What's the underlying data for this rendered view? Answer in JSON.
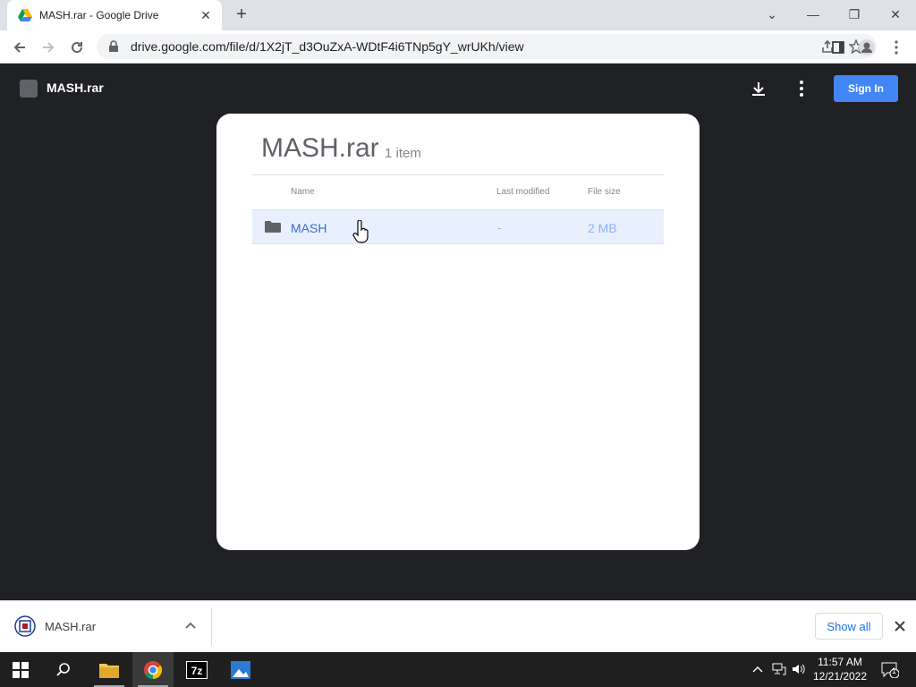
{
  "browser": {
    "tab_title": "MASH.rar - Google Drive",
    "new_tab_label": "+",
    "url": "drive.google.com/file/d/1X2jT_d3OuZxA-WDtF4i6TNp5gY_wrUKh/view"
  },
  "viewer": {
    "file_name": "MASH.rar",
    "sign_in_label": "Sign In",
    "card": {
      "title": "MASH.rar",
      "count": "1 item",
      "columns": [
        "Name",
        "Last modified",
        "File size"
      ],
      "rows": [
        {
          "name": "MASH",
          "modified": "-",
          "size": "2 MB"
        }
      ]
    }
  },
  "downloads": {
    "item_name": "MASH.rar",
    "show_all_label": "Show all"
  },
  "taskbar": {
    "time": "11:57 AM",
    "date": "12/21/2022",
    "notification_count": "1"
  },
  "colors": {
    "accent": "#4285f4",
    "viewer_bg": "#202124",
    "row_highlight": "#e8f0fe"
  }
}
